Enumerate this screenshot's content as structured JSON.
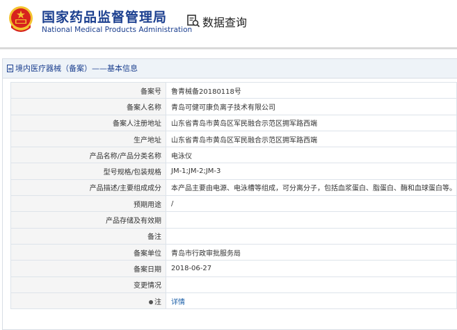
{
  "header": {
    "org_cn": "国家药品监督管理局",
    "org_en": "National Medical Products Administration",
    "query_label": "数据查询"
  },
  "panel": {
    "title": "境内医疗器械（备案）——基本信息"
  },
  "rows": [
    {
      "label": "备案号",
      "value": "鲁青械备20180118号"
    },
    {
      "label": "备案人名称",
      "value": "青岛可健可康负离子技术有限公司"
    },
    {
      "label": "备案人注册地址",
      "value": "山东省青岛市黄岛区军民融合示范区拥军路西端"
    },
    {
      "label": "生产地址",
      "value": "山东省青岛市黄岛区军民融合示范区拥军路西端"
    },
    {
      "label": "产品名称/产品分类名称",
      "value": "电泳仪"
    },
    {
      "label": "型号规格/包装规格",
      "value": "JM-1;JM-2;JM-3"
    },
    {
      "label": "产品描述/主要组成成分",
      "value": "本产品主要由电源、电泳槽等组成，可分离分子，包括血浆蛋白、脂蛋白、酶和血球蛋白等。"
    },
    {
      "label": "预期用途",
      "value": "/"
    },
    {
      "label": "产品存储及有效期",
      "value": ""
    },
    {
      "label": "备注",
      "value": ""
    },
    {
      "label": "备案单位",
      "value": "青岛市行政审批服务局"
    },
    {
      "label": "备案日期",
      "value": "2018-06-27"
    },
    {
      "label": "变更情况",
      "value": ""
    },
    {
      "label": "注",
      "value": "详情"
    }
  ],
  "colors": {
    "brand_blue": "#1b3f8f",
    "emblem_red": "#d7231d",
    "emblem_gold": "#f4c430",
    "link_blue": "#1b5fa8"
  }
}
